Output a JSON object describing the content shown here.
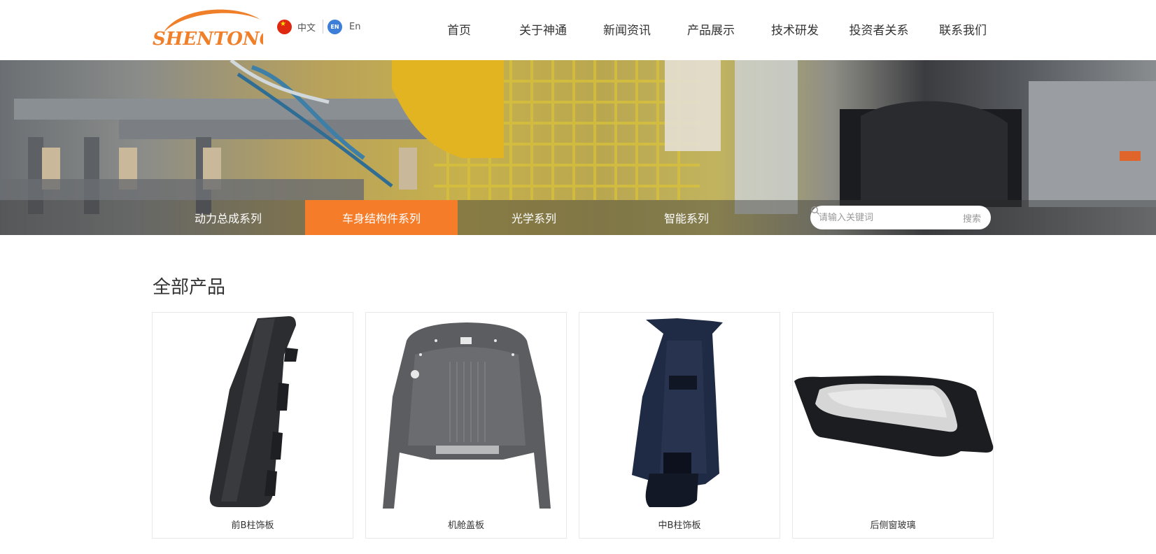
{
  "header": {
    "logo_text": "SHENTONG",
    "lang": {
      "cn_label": "中文",
      "en_badge": "EN",
      "en_label": "En"
    },
    "nav": [
      "首页",
      "关于神通",
      "新闻资讯",
      "产品展示",
      "技术研发",
      "投资者关系",
      "联系我们"
    ]
  },
  "banner": {
    "tabs": [
      {
        "label": "动力总成系列",
        "active": false
      },
      {
        "label": "车身结构件系列",
        "active": true
      },
      {
        "label": "光学系列",
        "active": false
      },
      {
        "label": "智能系列",
        "active": false
      }
    ],
    "search": {
      "placeholder": "请输入关键词",
      "button_label": "搜索"
    }
  },
  "main": {
    "title": "全部产品",
    "products": [
      {
        "name": "前B柱饰板"
      },
      {
        "name": "机舱盖板"
      },
      {
        "name": "中B柱饰板"
      },
      {
        "name": "后侧窗玻璃"
      }
    ]
  },
  "colors": {
    "accent": "#f57d2a",
    "logo": "#f07f2a"
  }
}
